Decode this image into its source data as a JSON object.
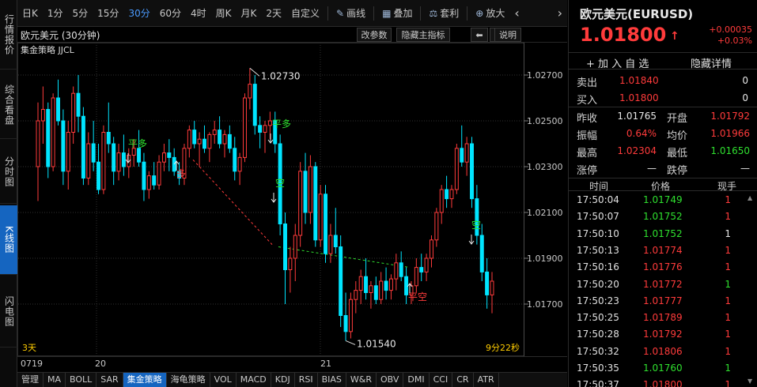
{
  "left_tabs": [
    {
      "label": "行情报价",
      "active": false
    },
    {
      "label": "综合看盘",
      "active": false
    },
    {
      "label": "分时图",
      "active": false
    },
    {
      "label": "K线图",
      "active": true
    },
    {
      "label": "闪电图",
      "active": false
    }
  ],
  "toolbar": {
    "periods": [
      "日K",
      "1分",
      "5分",
      "15分",
      "30分",
      "60分",
      "4时",
      "周K",
      "月K",
      "2天",
      "自定义"
    ],
    "active_period": "30分",
    "draw_label": "画线",
    "overlay_label": "叠加",
    "arbitrage_label": "套利",
    "zoom_label": "放大",
    "nav_left": "‹",
    "nav_right": "›"
  },
  "chart_header": {
    "title": "欧元美元 (30分钟)",
    "edit_params": "改参数",
    "hide_indicator": "隐藏主指标",
    "left_arrow": "⬅",
    "right_arrow": "➡",
    "help": "说明"
  },
  "strategy_label": "集金策略 JJCL",
  "time_left": "3天",
  "time_right": "9分22秒",
  "date_axis": [
    "0719",
    "20",
    "21"
  ],
  "bottom_tabs": [
    "管理",
    "MA",
    "BOLL",
    "SAR",
    "集金策略",
    "海龟策略",
    "VOL",
    "MACD",
    "KDJ",
    "RSI",
    "BIAS",
    "W&R",
    "OBV",
    "DMI",
    "CCI",
    "CR",
    "ATR"
  ],
  "bottom_active": "集金策略",
  "colors": {
    "up": "#ff3b3b",
    "down": "#00e5ff",
    "signal_flat": "#2fe02f",
    "signal_long": "#ff3b3b",
    "axis_text": "#c8c8c8",
    "accent": "#1565c0"
  },
  "chart_data": {
    "type": "candlestick",
    "y_ticks": [
      "1.02700",
      "1.02500",
      "1.02300",
      "1.02100",
      "1.01900",
      "1.01700"
    ],
    "ylim": [
      1.015,
      1.0285
    ],
    "annotations": [
      {
        "label": "1.02730",
        "value": 1.0273
      },
      {
        "label": "1.01540",
        "value": 1.0154
      }
    ],
    "signals": [
      {
        "label": "平多",
        "kind": "flat"
      },
      {
        "label": "多",
        "kind": "long"
      },
      {
        "label": "平多",
        "kind": "flat"
      },
      {
        "label": "空",
        "kind": "flat"
      },
      {
        "label": "平空",
        "kind": "long"
      },
      {
        "label": "空",
        "kind": "flat"
      }
    ],
    "candles": [
      [
        1.023,
        1.0258,
        1.0215,
        1.025
      ],
      [
        1.025,
        1.0265,
        1.024,
        1.0255
      ],
      [
        1.0255,
        1.0258,
        1.0225,
        1.023
      ],
      [
        1.023,
        1.0262,
        1.0228,
        1.026
      ],
      [
        1.026,
        1.0268,
        1.0248,
        1.025
      ],
      [
        1.025,
        1.0255,
        1.0222,
        1.0228
      ],
      [
        1.0228,
        1.025,
        1.022,
        1.0245
      ],
      [
        1.0245,
        1.0265,
        1.024,
        1.0262
      ],
      [
        1.0262,
        1.027,
        1.0245,
        1.0252
      ],
      [
        1.0252,
        1.0256,
        1.0222,
        1.0225
      ],
      [
        1.0225,
        1.0245,
        1.0222,
        1.024
      ],
      [
        1.024,
        1.025,
        1.0228,
        1.0232
      ],
      [
        1.0232,
        1.024,
        1.0218,
        1.022
      ],
      [
        1.022,
        1.0248,
        1.0218,
        1.0245
      ],
      [
        1.0245,
        1.0258,
        1.0236,
        1.024
      ],
      [
        1.024,
        1.0243,
        1.0222,
        1.0228
      ],
      [
        1.0228,
        1.024,
        1.0224,
        1.0236
      ],
      [
        1.0236,
        1.0244,
        1.0226,
        1.023
      ],
      [
        1.023,
        1.0238,
        1.0225,
        1.0235
      ],
      [
        1.0235,
        1.0242,
        1.023,
        1.0238
      ],
      [
        1.0238,
        1.0246,
        1.023,
        1.0232
      ],
      [
        1.0232,
        1.0236,
        1.0215,
        1.022
      ],
      [
        1.022,
        1.0228,
        1.0216,
        1.0226
      ],
      [
        1.0226,
        1.0232,
        1.022,
        1.0222
      ],
      [
        1.0222,
        1.0235,
        1.022,
        1.0232
      ],
      [
        1.0232,
        1.024,
        1.0228,
        1.0236
      ],
      [
        1.0236,
        1.0242,
        1.0228,
        1.0234
      ],
      [
        1.0234,
        1.0238,
        1.0226,
        1.0228
      ],
      [
        1.0228,
        1.0232,
        1.0222,
        1.0225
      ],
      [
        1.0225,
        1.024,
        1.0222,
        1.0238
      ],
      [
        1.0238,
        1.0248,
        1.0234,
        1.0246
      ],
      [
        1.0246,
        1.025,
        1.0238,
        1.024
      ],
      [
        1.024,
        1.0245,
        1.023,
        1.0242
      ],
      [
        1.0242,
        1.0248,
        1.0236,
        1.0238
      ],
      [
        1.0238,
        1.0245,
        1.0232,
        1.0244
      ],
      [
        1.0244,
        1.025,
        1.024,
        1.0246
      ],
      [
        1.0246,
        1.0252,
        1.0238,
        1.024
      ],
      [
        1.024,
        1.0246,
        1.0234,
        1.0244
      ],
      [
        1.0244,
        1.0248,
        1.0236,
        1.0238
      ],
      [
        1.0238,
        1.0243,
        1.0224,
        1.0228
      ],
      [
        1.0228,
        1.0236,
        1.0222,
        1.0234
      ],
      [
        1.0234,
        1.0262,
        1.0232,
        1.026
      ],
      [
        1.026,
        1.0273,
        1.0255,
        1.0266
      ],
      [
        1.0266,
        1.027,
        1.0244,
        1.0248
      ],
      [
        1.0248,
        1.0252,
        1.0238,
        1.0245
      ],
      [
        1.0245,
        1.025,
        1.0236,
        1.0248
      ],
      [
        1.0248,
        1.0254,
        1.0242,
        1.025
      ],
      [
        1.025,
        1.0254,
        1.0236,
        1.024
      ],
      [
        1.024,
        1.0244,
        1.02,
        1.0205
      ],
      [
        1.0205,
        1.021,
        1.017,
        1.0185
      ],
      [
        1.0185,
        1.0195,
        1.0175,
        1.019
      ],
      [
        1.019,
        1.0205,
        1.018,
        1.02
      ],
      [
        1.02,
        1.0232,
        1.0195,
        1.0228
      ],
      [
        1.0228,
        1.0236,
        1.0205,
        1.021
      ],
      [
        1.021,
        1.0235,
        1.0205,
        1.023
      ],
      [
        1.023,
        1.0232,
        1.0195,
        1.0198
      ],
      [
        1.0198,
        1.0222,
        1.0195,
        1.0218
      ],
      [
        1.0218,
        1.0222,
        1.0188,
        1.0192
      ],
      [
        1.0192,
        1.0205,
        1.0188,
        1.02
      ],
      [
        1.02,
        1.0212,
        1.0192,
        1.0195
      ],
      [
        1.0195,
        1.02,
        1.016,
        1.0165
      ],
      [
        1.0165,
        1.0175,
        1.0154,
        1.0158
      ],
      [
        1.0158,
        1.0175,
        1.0155,
        1.0172
      ],
      [
        1.0172,
        1.018,
        1.0166,
        1.0176
      ],
      [
        1.0176,
        1.0185,
        1.017,
        1.0182
      ],
      [
        1.0182,
        1.019,
        1.0172,
        1.0175
      ],
      [
        1.0175,
        1.018,
        1.0168,
        1.0178
      ],
      [
        1.0178,
        1.0182,
        1.017,
        1.0172
      ],
      [
        1.0172,
        1.0184,
        1.017,
        1.018
      ],
      [
        1.018,
        1.0186,
        1.0172,
        1.0176
      ],
      [
        1.0176,
        1.0183,
        1.0172,
        1.0181
      ],
      [
        1.0181,
        1.0192,
        1.0176,
        1.0188
      ],
      [
        1.0188,
        1.0193,
        1.018,
        1.0182
      ],
      [
        1.0182,
        1.0186,
        1.017,
        1.0174
      ],
      [
        1.0174,
        1.018,
        1.017,
        1.0178
      ],
      [
        1.0178,
        1.019,
        1.0175,
        1.0186
      ],
      [
        1.0186,
        1.0192,
        1.018,
        1.0184
      ],
      [
        1.0184,
        1.0192,
        1.018,
        1.019
      ],
      [
        1.019,
        1.02,
        1.0186,
        1.0198
      ],
      [
        1.0198,
        1.0212,
        1.0195,
        1.021
      ],
      [
        1.021,
        1.0222,
        1.0205,
        1.022
      ],
      [
        1.022,
        1.0226,
        1.0212,
        1.0216
      ],
      [
        1.0216,
        1.0222,
        1.0212,
        1.022
      ],
      [
        1.022,
        1.024,
        1.0218,
        1.0238
      ],
      [
        1.0238,
        1.0248,
        1.023,
        1.0232
      ],
      [
        1.0232,
        1.0243,
        1.0226,
        1.024
      ],
      [
        1.024,
        1.0243,
        1.0212,
        1.0216
      ],
      [
        1.0216,
        1.0222,
        1.0196,
        1.02
      ],
      [
        1.02,
        1.0205,
        1.018,
        1.0184
      ],
      [
        1.0184,
        1.019,
        1.0168,
        1.0174
      ],
      [
        1.0174,
        1.0184,
        1.0166,
        1.018
      ]
    ]
  },
  "right_panel": {
    "title": "欧元美元(EURUSD)",
    "price": "1.01800",
    "arrow": "↑",
    "change": "+0.00035",
    "change_pct": "+0.03%",
    "add_fav": "+ 加 入 自 选",
    "hide_detail": "隐藏详情",
    "sell": {
      "label": "卖出",
      "price": "1.01840",
      "qty": "0"
    },
    "buy": {
      "label": "买入",
      "price": "1.01800",
      "qty": "0"
    },
    "stats": [
      {
        "l1": "昨收",
        "v1": "1.01765",
        "c1": "white",
        "l2": "开盘",
        "v2": "1.01792",
        "c2": "red"
      },
      {
        "l1": "振幅",
        "v1": "0.64%",
        "c1": "red",
        "l2": "均价",
        "v2": "1.01966",
        "c2": "red"
      },
      {
        "l1": "最高",
        "v1": "1.02304",
        "c1": "red",
        "l2": "最低",
        "v2": "1.01650",
        "c2": "green"
      },
      {
        "l1": "涨停",
        "v1": "—",
        "c1": "white",
        "l2": "跌停",
        "v2": "—",
        "c2": "white"
      }
    ],
    "tick_header": {
      "time": "时间",
      "price": "价格",
      "vol": "现手"
    },
    "ticks": [
      {
        "time": "17:50:04",
        "price": "1.01749",
        "pc": "green",
        "vol": "1",
        "vc": "red"
      },
      {
        "time": "17:50:07",
        "price": "1.01752",
        "pc": "green",
        "vol": "1",
        "vc": "red"
      },
      {
        "time": "17:50:10",
        "price": "1.01752",
        "pc": "green",
        "vol": "1",
        "vc": "white"
      },
      {
        "time": "17:50:13",
        "price": "1.01774",
        "pc": "red",
        "vol": "1",
        "vc": "red"
      },
      {
        "time": "17:50:16",
        "price": "1.01776",
        "pc": "red",
        "vol": "1",
        "vc": "red"
      },
      {
        "time": "17:50:20",
        "price": "1.01772",
        "pc": "red",
        "vol": "1",
        "vc": "green"
      },
      {
        "time": "17:50:23",
        "price": "1.01777",
        "pc": "red",
        "vol": "1",
        "vc": "red"
      },
      {
        "time": "17:50:25",
        "price": "1.01789",
        "pc": "red",
        "vol": "1",
        "vc": "red"
      },
      {
        "time": "17:50:28",
        "price": "1.01792",
        "pc": "red",
        "vol": "1",
        "vc": "red"
      },
      {
        "time": "17:50:32",
        "price": "1.01806",
        "pc": "red",
        "vol": "1",
        "vc": "red"
      },
      {
        "time": "17:50:35",
        "price": "1.01760",
        "pc": "green",
        "vol": "1",
        "vc": "green"
      },
      {
        "time": "17:50:37",
        "price": "1.01800",
        "pc": "red",
        "vol": "1",
        "vc": "red"
      }
    ]
  }
}
